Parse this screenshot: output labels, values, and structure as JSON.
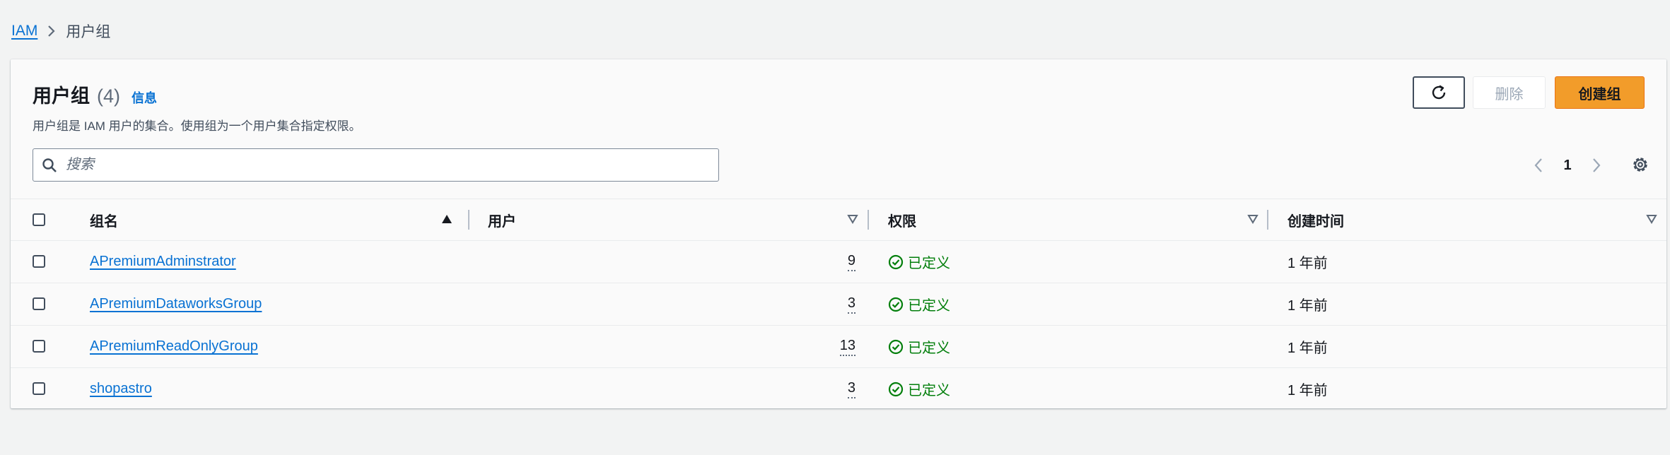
{
  "breadcrumb": {
    "root": "IAM",
    "current": "用户组"
  },
  "header": {
    "title": "用户组",
    "count": "(4)",
    "info": "信息",
    "description": "用户组是 IAM 用户的集合。使用组为一个用户集合指定权限。"
  },
  "actions": {
    "delete_label": "删除",
    "create_label": "创建组"
  },
  "search": {
    "placeholder": "搜索",
    "value": ""
  },
  "pagination": {
    "current_page": "1"
  },
  "table": {
    "columns": [
      "组名",
      "用户",
      "权限",
      "创建时间"
    ],
    "rows": [
      {
        "name": "APremiumAdminstrator",
        "users": "9",
        "permissions": "已定义",
        "created": "1 年前"
      },
      {
        "name": "APremiumDataworksGroup",
        "users": "3",
        "permissions": "已定义",
        "created": "1 年前"
      },
      {
        "name": "APremiumReadOnlyGroup",
        "users": "13",
        "permissions": "已定义",
        "created": "1 年前"
      },
      {
        "name": "shopastro",
        "users": "3",
        "permissions": "已定义",
        "created": "1 年前"
      }
    ]
  },
  "colors": {
    "link": "#0972d3",
    "primary_button": "#f29c2a",
    "success": "#037f0c"
  }
}
